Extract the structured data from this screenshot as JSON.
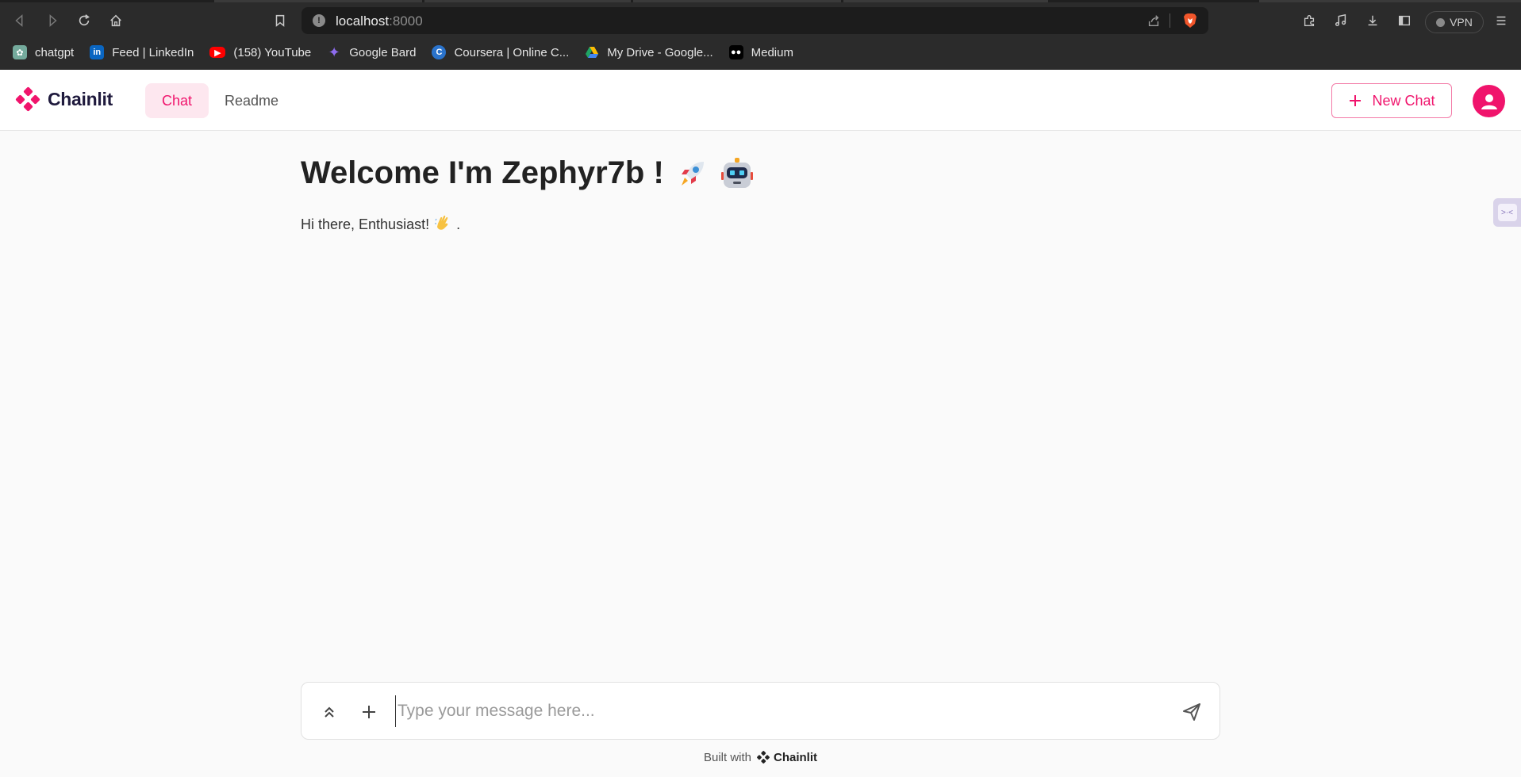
{
  "browser": {
    "url_host": "localhost",
    "url_port": ":8000",
    "vpn_label": "VPN",
    "bookmarks": [
      {
        "label": "chatgpt",
        "icon": "openai-icon",
        "color": "#74aa9c"
      },
      {
        "label": "Feed | LinkedIn",
        "icon": "linkedin-icon",
        "color": "#0a66c2"
      },
      {
        "label": "(158) YouTube",
        "icon": "youtube-icon",
        "color": "#ff0000"
      },
      {
        "label": "Google Bard",
        "icon": "bard-icon",
        "color": "#8e6cef"
      },
      {
        "label": "Coursera | Online C...",
        "icon": "coursera-icon",
        "color": "#2a73cc"
      },
      {
        "label": "My Drive - Google...",
        "icon": "google-drive-icon",
        "color": "#1fa463"
      },
      {
        "label": "Medium",
        "icon": "medium-icon",
        "color": "#000000"
      }
    ]
  },
  "app": {
    "brand": "Chainlit",
    "accent": "#f0146c",
    "nav": {
      "chat": "Chat",
      "readme": "Readme"
    },
    "new_chat": "New Chat"
  },
  "main": {
    "welcome_title": "Welcome I'm Zephyr7b !",
    "welcome_emojis": [
      "rocket-icon",
      "robot-icon"
    ],
    "greeting": "Hi there, Enthusiast!",
    "greeting_emoji": "waving-hand-icon",
    "greeting_end": "."
  },
  "composer": {
    "placeholder": "Type your message here..."
  },
  "footer": {
    "built_with": "Built with",
    "brand": "Chainlit"
  }
}
